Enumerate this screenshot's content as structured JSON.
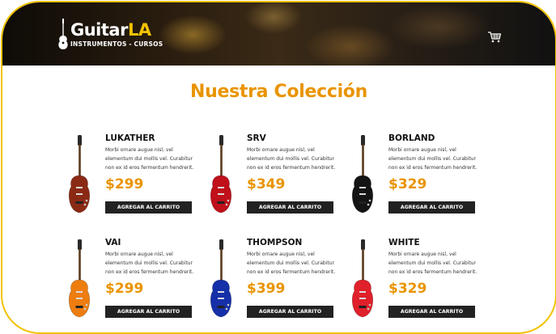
{
  "brand": {
    "name": "Guitar",
    "accent": "LA",
    "tagline": "INSTRUMENTOS - CURSOS"
  },
  "icons": {
    "logo": "guitar-icon",
    "cart": "cart-icon"
  },
  "colors": {
    "accent": "#e99400",
    "frame": "#f2c200",
    "button": "#222222"
  },
  "heading": "Nuestra Colección",
  "products": [
    {
      "name": "LUKATHER",
      "desc": "Morbi ornare augue nisl, vel elementum dui mollis vel. Curabitur non ex id eros fermentum hendrerit.",
      "price": "$299",
      "button": "AGREGAR AL CARRITO",
      "body_color": "#8b2a14"
    },
    {
      "name": "SRV",
      "desc": "Morbi ornare augue nisl, vel elementum dui mollis vel. Curabitur non ex id eros fermentum hendrerit.",
      "price": "$349",
      "button": "AGREGAR AL CARRITO",
      "body_color": "#c0101a"
    },
    {
      "name": "BORLAND",
      "desc": "Morbi ornare augue nisl, vel elementum dui mollis vel. Curabitur non ex id eros fermentum hendrerit.",
      "price": "$329",
      "button": "AGREGAR AL CARRITO",
      "body_color": "#141414"
    },
    {
      "name": "VAI",
      "desc": "Morbi ornare augue nisl, vel elementum dui mollis vel. Curabitur non ex id eros fermentum hendrerit.",
      "price": "$299",
      "button": "AGREGAR AL CARRITO",
      "body_color": "#ee7d10"
    },
    {
      "name": "THOMPSON",
      "desc": "Morbi ornare augue nisl, vel elementum dui mollis vel. Curabitur non ex id eros fermentum hendrerit.",
      "price": "$399",
      "button": "AGREGAR AL CARRITO",
      "body_color": "#1530a8"
    },
    {
      "name": "WHITE",
      "desc": "Morbi ornare augue nisl, vel elementum dui mollis vel. Curabitur non ex id eros fermentum hendrerit.",
      "price": "$329",
      "button": "AGREGAR AL CARRITO",
      "body_color": "#e0202a"
    }
  ]
}
